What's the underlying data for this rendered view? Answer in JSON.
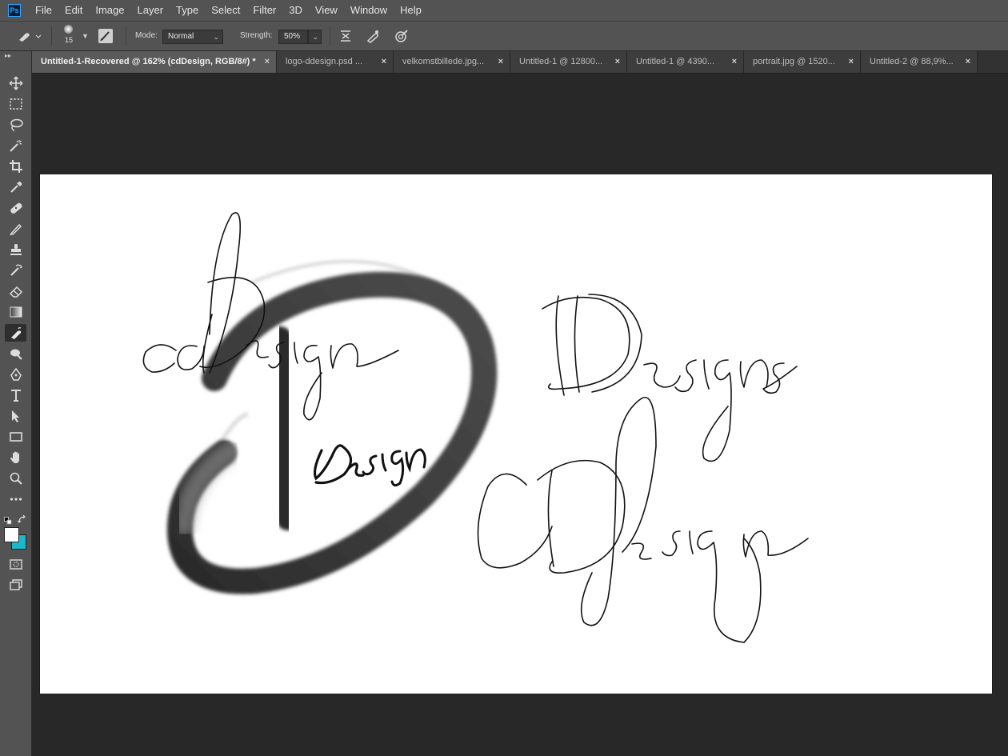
{
  "app": {
    "logo_text": "Ps"
  },
  "menu": [
    "File",
    "Edit",
    "Image",
    "Layer",
    "Type",
    "Select",
    "Filter",
    "3D",
    "View",
    "Window",
    "Help"
  ],
  "options": {
    "brush_size": "15",
    "mode_label": "Mode:",
    "mode_value": "Normal",
    "strength_label": "Strength:",
    "strength_value": "50%"
  },
  "tabs": [
    {
      "label": "Untitled-1-Recovered @ 162% (cdDesign, RGB/8#) *",
      "active": true
    },
    {
      "label": "logo-ddesign.psd ...",
      "active": false
    },
    {
      "label": "velkomstbillede.jpg...",
      "active": false
    },
    {
      "label": "Untitled-1 @ 12800...",
      "active": false
    },
    {
      "label": "Untitled-1 @ 4390...",
      "active": false
    },
    {
      "label": "portrait.jpg @ 1520...",
      "active": false
    },
    {
      "label": "Untitled-2 @ 88,9%...",
      "active": false
    }
  ],
  "tab_close_glyph": "×",
  "tools": [
    "move-icon",
    "marquee-icon",
    "lasso-icon",
    "magic-wand-icon",
    "crop-icon",
    "eyedropper-icon",
    "healing-brush-icon",
    "brush-icon",
    "clone-stamp-icon",
    "history-brush-icon",
    "eraser-icon",
    "gradient-icon",
    "smudge-icon",
    "dodge-icon",
    "pen-icon",
    "type-icon",
    "path-selection-icon",
    "rectangle-icon",
    "hand-icon",
    "zoom-icon",
    "more-tools-icon"
  ],
  "active_tool": "smudge-icon",
  "colors": {
    "foreground": "#ffffff",
    "background": "#1bb8c9",
    "canvas_bg": "#ffffff",
    "workspace": "#282828"
  },
  "artwork": {
    "text_1": "cdDesign",
    "text_2": "Design",
    "text_3": "DDesigns",
    "text_4": "CDdesign"
  }
}
